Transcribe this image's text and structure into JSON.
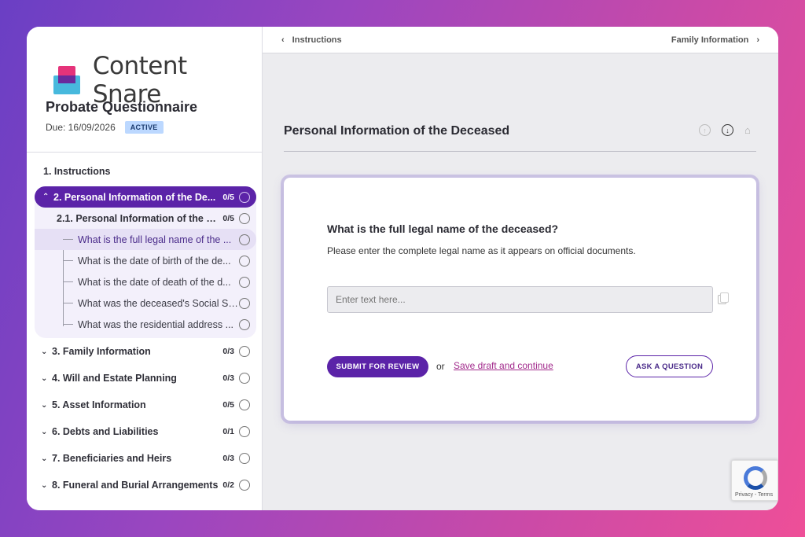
{
  "brand": {
    "name": "Content Snare"
  },
  "project": {
    "title": "Probate Questionnaire",
    "due": "Due: 16/09/2026",
    "status": "ACTIVE"
  },
  "nav": {
    "instructions": "1. Instructions",
    "active_section": {
      "label": "2. Personal Information of the De...",
      "count": "0/5"
    },
    "subsection": {
      "label": "2.1. Personal Information of the D...",
      "count": "0/5"
    },
    "questions": [
      "What is the full legal name of the ...",
      "What is the date of birth of the de...",
      "What is the date of death of the d...",
      "What was the deceased's Social Se...",
      "What was the residential address ..."
    ],
    "sections": [
      {
        "label": "3. Family Information",
        "count": "0/3"
      },
      {
        "label": "4. Will and Estate Planning",
        "count": "0/3"
      },
      {
        "label": "5. Asset Information",
        "count": "0/5"
      },
      {
        "label": "6. Debts and Liabilities",
        "count": "0/1"
      },
      {
        "label": "7. Beneficiaries and Heirs",
        "count": "0/3"
      },
      {
        "label": "8. Funeral and Burial Arrangements",
        "count": "0/2"
      }
    ]
  },
  "topbar": {
    "prev": "Instructions",
    "next": "Family Information"
  },
  "page": {
    "title": "Personal Information of the Deceased"
  },
  "question": {
    "title": "What is the full legal name of the deceased?",
    "description": "Please enter the complete legal name as it appears on official documents.",
    "placeholder": "Enter text here...",
    "submit_label": "SUBMIT FOR REVIEW",
    "or_text": "or",
    "save_label": "Save draft and continue",
    "ask_label": "ASK A QUESTION"
  },
  "recaptcha": {
    "text": "Privacy - Terms"
  },
  "colors": {
    "accent": "#5b23a8",
    "link": "#a22a8c",
    "badge_bg": "#bcd8ff"
  }
}
